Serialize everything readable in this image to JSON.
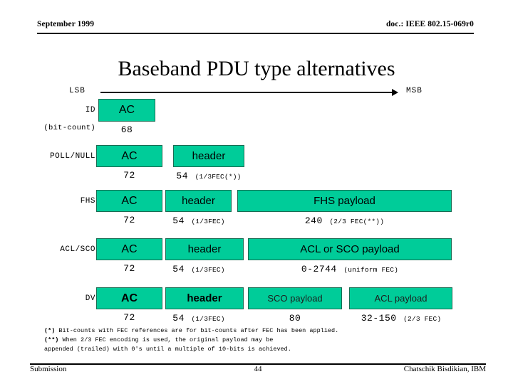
{
  "header": {
    "date": "September 1999",
    "doc": "doc.: IEEE 802.15-069r0"
  },
  "title": "Baseband PDU type alternatives",
  "axis": {
    "lsb": "LSB",
    "msb": "MSB"
  },
  "rows": [
    {
      "label": "ID",
      "sublabel": "(bit-count)",
      "fields": [
        {
          "name": "AC",
          "count": "68",
          "fec": ""
        }
      ]
    },
    {
      "label": "POLL/NULL",
      "sublabel": "",
      "fields": [
        {
          "name": "AC",
          "count": "72",
          "fec": ""
        },
        {
          "name": "header",
          "count": "54",
          "fec": "(1/3FEC(*))"
        }
      ]
    },
    {
      "label": "FHS",
      "sublabel": "",
      "fields": [
        {
          "name": "AC",
          "count": "72",
          "fec": ""
        },
        {
          "name": "header",
          "count": "54",
          "fec": "(1/3FEC)"
        },
        {
          "name": "FHS payload",
          "count": "240",
          "fec": "(2/3 FEC(**))"
        }
      ]
    },
    {
      "label": "ACL/SCO",
      "sublabel": "",
      "fields": [
        {
          "name": "AC",
          "count": "72",
          "fec": ""
        },
        {
          "name": "header",
          "count": "54",
          "fec": "(1/3FEC)"
        },
        {
          "name": "ACL or SCO payload",
          "count": "0-2744",
          "fec": "(uniform FEC)"
        }
      ]
    },
    {
      "label": "DV",
      "sublabel": "",
      "fields": [
        {
          "name": "AC",
          "count": "72",
          "fec": ""
        },
        {
          "name": "header",
          "count": "54",
          "fec": "(1/3FEC)"
        },
        {
          "name": "SCO payload",
          "count": "80",
          "fec": ""
        },
        {
          "name": "ACL payload",
          "count": "32-150",
          "fec": "(2/3 FEC)"
        }
      ]
    }
  ],
  "notes": {
    "star_marker": "(*)",
    "star_text": " Bit-counts with FEC references are for bit-counts after FEC has been applied.",
    "dstar_marker": "(**)",
    "dstar_text": " When 2/3 FEC encoding is used, the original payload may be",
    "dstar_text2": "appended (trailed) with 0's until a multiple of 10-bits is achieved."
  },
  "footer": {
    "left": "Submission",
    "page": "44",
    "right": "Chatschik Bisdikian, IBM"
  },
  "colors": {
    "box_fill": "#00CC99",
    "box_border": "#1a6b52"
  }
}
